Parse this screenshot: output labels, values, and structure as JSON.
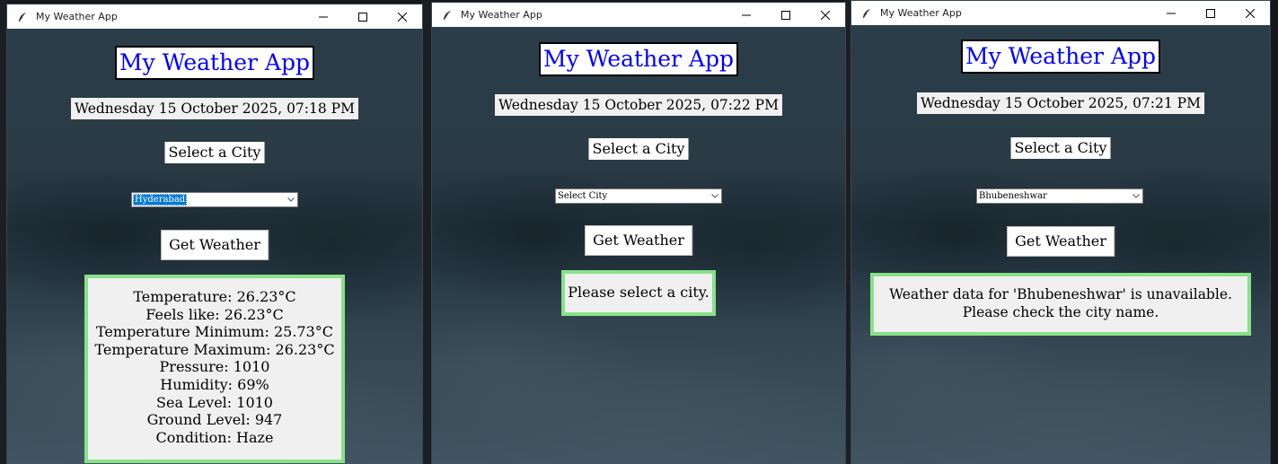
{
  "windows": [
    {
      "title": "My Weather App",
      "heading": "My Weather App",
      "datetime": "Wednesday 15 October 2025, 07:18 PM",
      "select_label": "Select a City",
      "city_value": "Hyderabad",
      "get_weather_label": "Get Weather",
      "result_lines": [
        "Temperature: 26.23°C",
        "Feels like: 26.23°C",
        "Temperature Minimum: 25.73°C",
        "Temperature Maximum: 26.23°C",
        "Pressure: 1010",
        "Humidity: 69%",
        "Sea Level: 1010",
        "Ground Level: 947",
        "Condition: Haze"
      ]
    },
    {
      "title": "My Weather App",
      "heading": "My Weather App",
      "datetime": "Wednesday 15 October 2025, 07:22 PM",
      "select_label": "Select a City",
      "city_value": "Select City",
      "get_weather_label": "Get Weather",
      "result_lines": [
        "Please select a city."
      ]
    },
    {
      "title": "My Weather App",
      "heading": "My Weather App",
      "datetime": "Wednesday 15 October 2025, 07:21 PM",
      "select_label": "Select a City",
      "city_value": "Bhubeneshwar",
      "get_weather_label": "Get Weather",
      "result_lines": [
        "Weather data for 'Bhubeneshwar' is unavailable.",
        "Please check the city name."
      ]
    }
  ],
  "icons": {
    "app": "feather-icon",
    "minimize": "minimize-icon",
    "maximize": "maximize-icon",
    "close": "close-icon",
    "dropdown": "chevron-down-icon"
  },
  "colors": {
    "heading_text": "#0000ff",
    "result_border": "#88e288",
    "combo_selection": "#0078d7"
  }
}
